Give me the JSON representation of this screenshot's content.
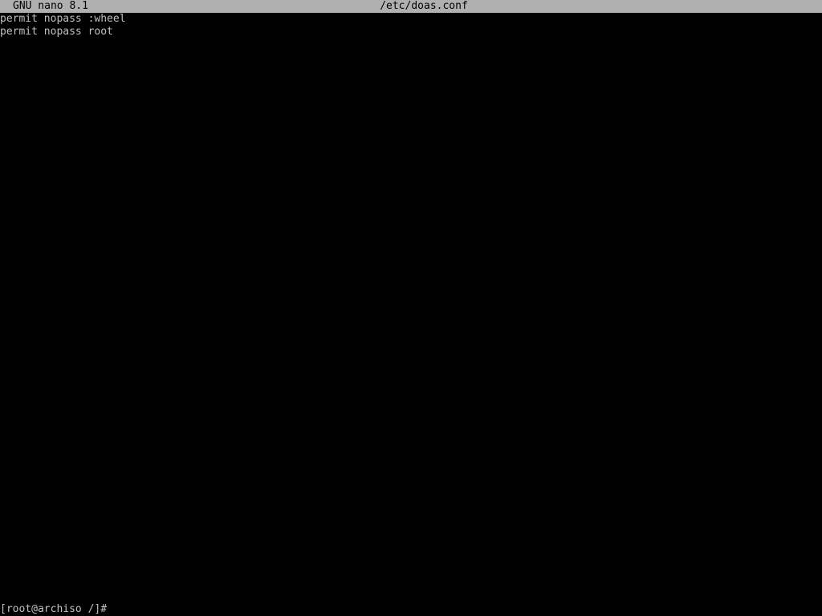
{
  "editor": {
    "app_name": "GNU nano 8.1",
    "file_name": "/etc/doas.conf"
  },
  "buffer": {
    "lines": [
      "permit nopass :wheel",
      "permit nopass root"
    ]
  },
  "shell": {
    "prompt": "[root@archiso /]#"
  },
  "colors": {
    "background": "#000000",
    "titlebar_bg": "#b0b0b0",
    "titlebar_fg": "#000000",
    "text": "#c0c0c0"
  }
}
